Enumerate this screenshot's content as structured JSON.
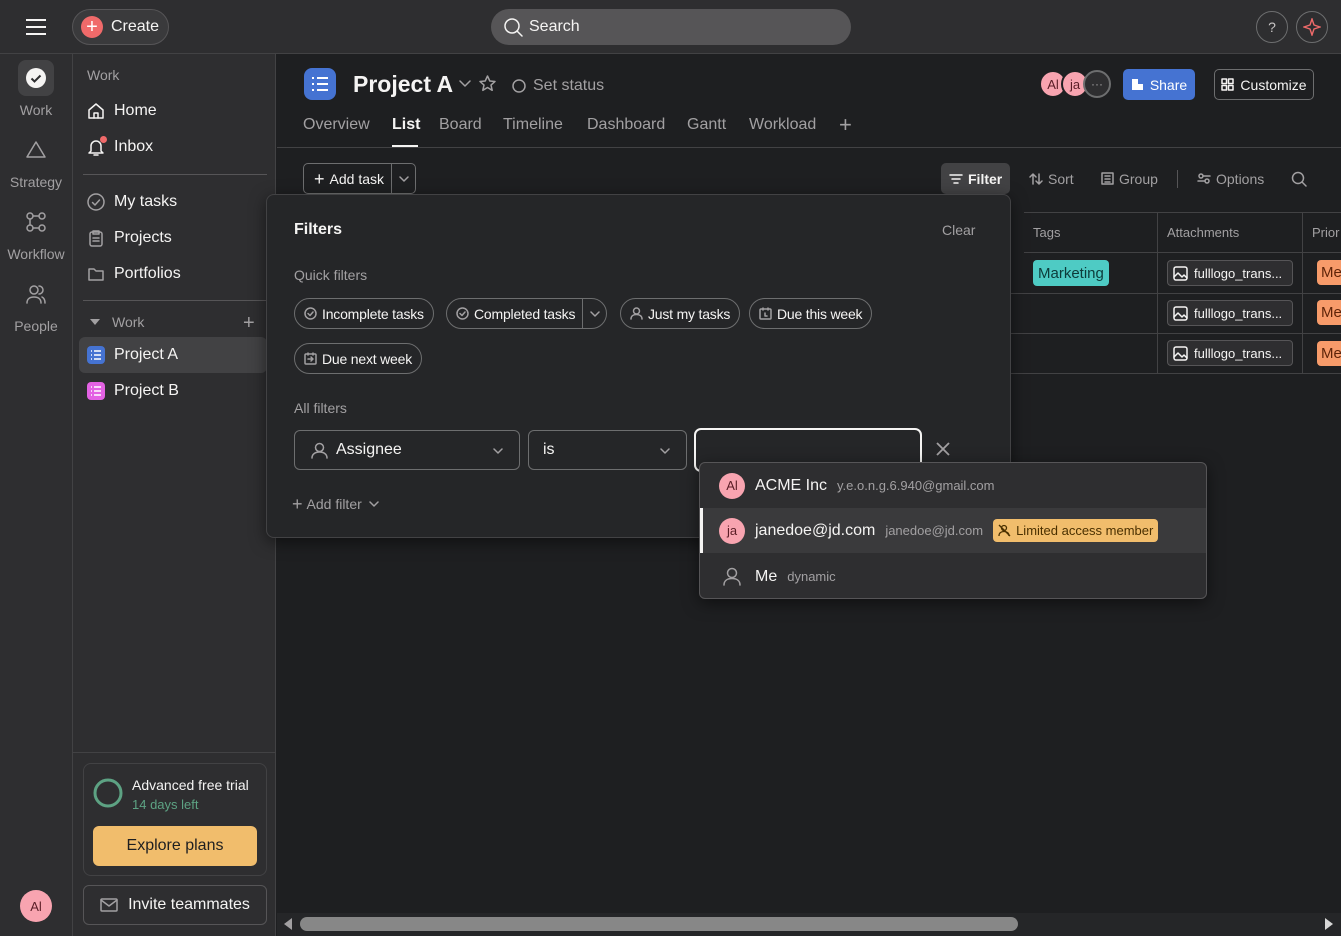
{
  "topbar": {
    "create_label": "Create",
    "search_label": "Search",
    "help_label": "?"
  },
  "rail": {
    "items": [
      {
        "label": "Work",
        "icon": "check-circle-icon"
      },
      {
        "label": "Strategy",
        "icon": "triangle-icon"
      },
      {
        "label": "Workflow",
        "icon": "workflow-icon"
      },
      {
        "label": "People",
        "icon": "people-icon"
      }
    ],
    "avatar_initials": "Al"
  },
  "sidebar": {
    "section_title": "Work",
    "nav": [
      {
        "label": "Home",
        "icon": "home-icon"
      },
      {
        "label": "Inbox",
        "icon": "bell-icon"
      }
    ],
    "nav2": [
      {
        "label": "My tasks",
        "icon": "check-circle-icon"
      },
      {
        "label": "Projects",
        "icon": "clipboard-icon"
      },
      {
        "label": "Portfolios",
        "icon": "folder-icon"
      }
    ],
    "group_title": "Work",
    "projects": [
      {
        "label": "Project A",
        "color": "#4573d2"
      },
      {
        "label": "Project B",
        "color": "#e362e3"
      }
    ],
    "trial": {
      "title": "Advanced free trial",
      "days_left": "14 days left",
      "button": "Explore plans"
    },
    "invite_label": "Invite teammates"
  },
  "project": {
    "title": "Project A",
    "set_status": "Set status",
    "tabs": [
      "Overview",
      "List",
      "Board",
      "Timeline",
      "Dashboard",
      "Gantt",
      "Workload"
    ],
    "active_tab": "List",
    "members": [
      "Al",
      "ja"
    ],
    "share_label": "Share",
    "customize_label": "Customize"
  },
  "toolbar": {
    "add_task_label": "Add task",
    "filter_label": "Filter",
    "sort_label": "Sort",
    "group_label": "Group",
    "options_label": "Options"
  },
  "table": {
    "columns": [
      "Tags",
      "Attachments",
      "Prior"
    ],
    "rows": [
      {
        "tag": "Marketing",
        "attachment": "fulllogo_trans...",
        "priority": "Me"
      },
      {
        "tag": "",
        "attachment": "fulllogo_trans...",
        "priority": "Me"
      },
      {
        "tag": "",
        "attachment": "fulllogo_trans...",
        "priority": "Me"
      }
    ]
  },
  "filters": {
    "title": "Filters",
    "clear_label": "Clear",
    "quick_title": "Quick filters",
    "quick": [
      "Incomplete tasks",
      "Completed tasks",
      "Just my tasks",
      "Due this week",
      "Due next week"
    ],
    "all_title": "All filters",
    "field": "Assignee",
    "operator": "is",
    "value": "",
    "add_filter_label": "Add filter"
  },
  "assignee_dropdown": [
    {
      "initials": "Al",
      "name": "ACME Inc",
      "email": "y.e.o.n.g.6.940@gmail.com",
      "badge": ""
    },
    {
      "initials": "ja",
      "name": "janedoe@jd.com",
      "email": "janedoe@jd.com",
      "badge": "Limited access member"
    },
    {
      "initials": "",
      "name": "Me",
      "email": "dynamic",
      "badge": ""
    }
  ]
}
